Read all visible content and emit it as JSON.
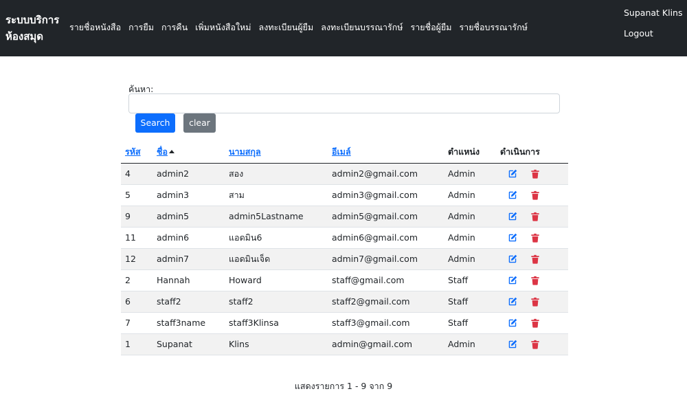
{
  "navbar": {
    "brand_line1": "ระบบบริการ",
    "brand_line2": "ห้องสมุด",
    "links": [
      "รายชื่อหนังสือ",
      "การยืม",
      "การคืน",
      "เพิ่มหนังสือใหม่",
      "ลงทะเบียนผู้ยืม",
      "ลงทะเบียนบรรณารักษ์",
      "รายชื่อผู้ยืม",
      "รายชื่อบรรณารักษ์"
    ],
    "user_name": "Supanat Klins",
    "logout_label": "Logout"
  },
  "search": {
    "label": "ค้นหา:",
    "value": "",
    "placeholder": "",
    "search_button": "Search",
    "clear_button": "clear"
  },
  "table": {
    "columns": [
      "รหัส",
      "ชื่อ",
      "นามสกุล",
      "อีเมล์",
      "ตำแหน่ง",
      "ดำเนินการ"
    ],
    "sorted_column": "ชื่อ",
    "sort_direction": "ascending",
    "rows": [
      [
        "4",
        "admin2",
        "สอง",
        "admin2@gmail.com",
        "Admin"
      ],
      [
        "5",
        "admin3",
        "สาม",
        "admin3@gmail.com",
        "Admin"
      ],
      [
        "9",
        "admin5",
        "admin5Lastname",
        "admin5@gmail.com",
        "Admin"
      ],
      [
        "11",
        "admin6",
        "แอดมิน6",
        "admin6@gmail.com",
        "Admin"
      ],
      [
        "12",
        "admin7",
        "แอดมินเจ็ด",
        "admin7@gmail.com",
        "Admin"
      ],
      [
        "2",
        "Hannah",
        "Howard",
        "staff@gmail.com",
        "Staff"
      ],
      [
        "6",
        "staff2",
        "staff2",
        "staff2@gmail.com",
        "Staff"
      ],
      [
        "7",
        "staff3name",
        "staff3Klinsa",
        "staff3@gmail.com",
        "Staff"
      ],
      [
        "1",
        "Supanat",
        "Klins",
        "admin@gmail.com",
        "Admin"
      ]
    ],
    "row_actions": [
      "edit-icon",
      "trash-icon"
    ]
  },
  "pagination": {
    "summary": "แสดงรายการ 1 - 9 จาก 9"
  },
  "colors": {
    "navbar_bg": "#212529",
    "primary": "#0d6efd",
    "secondary": "#6c757d",
    "danger": "#dc3545",
    "stripe": "#f2f2f2"
  }
}
